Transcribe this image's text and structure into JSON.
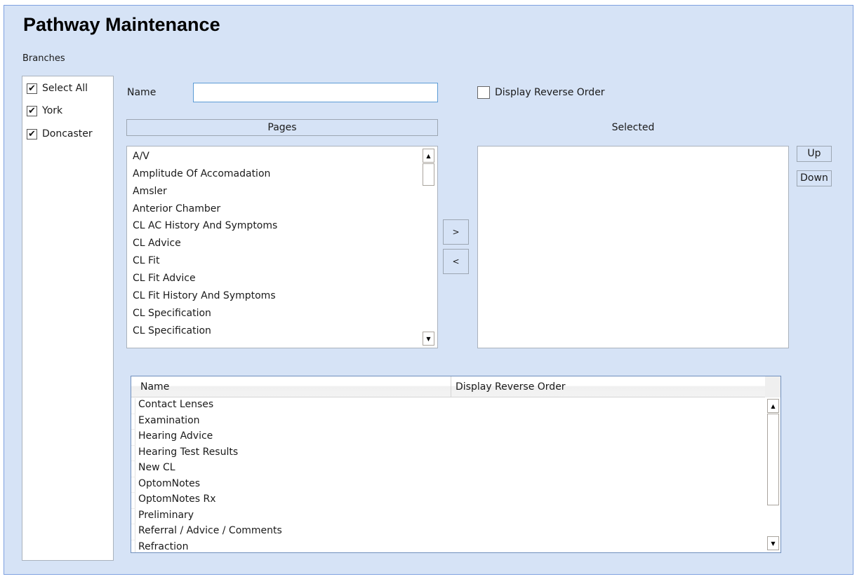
{
  "window": {
    "title": "Pathway Maintenance"
  },
  "branches": {
    "label": "Branches",
    "items": [
      {
        "label": "Select All",
        "checked": true
      },
      {
        "label": "York",
        "checked": true
      },
      {
        "label": "Doncaster",
        "checked": true
      }
    ]
  },
  "form": {
    "name_label": "Name",
    "name_value": "",
    "name_placeholder": "",
    "display_reverse_order_label": "Display Reverse Order",
    "display_reverse_order_checked": false
  },
  "pages": {
    "header": "Pages",
    "items": [
      "A/V",
      "Amplitude Of Accomadation",
      "Amsler",
      "Anterior Chamber",
      "CL AC History And Symptoms",
      "CL Advice",
      "CL Fit",
      "CL Fit Advice",
      "CL Fit History And Symptoms",
      "CL Specification",
      "CL Specification"
    ],
    "scroll_up_icon": "triangle-up-icon",
    "scroll_down_icon": "triangle-down-icon"
  },
  "transfer": {
    "add_label": ">",
    "remove_label": "<"
  },
  "selected": {
    "header": "Selected",
    "items": [],
    "up_label": "Up",
    "down_label": "Down"
  },
  "grid": {
    "columns": [
      "Name",
      "Display Reverse Order"
    ],
    "rows": [
      {
        "name": "Contact Lenses",
        "display_reverse_order": ""
      },
      {
        "name": "Examination",
        "display_reverse_order": ""
      },
      {
        "name": "Hearing Advice",
        "display_reverse_order": ""
      },
      {
        "name": "Hearing Test Results",
        "display_reverse_order": ""
      },
      {
        "name": "New CL",
        "display_reverse_order": ""
      },
      {
        "name": "OptomNotes",
        "display_reverse_order": ""
      },
      {
        "name": "OptomNotes Rx",
        "display_reverse_order": ""
      },
      {
        "name": "Preliminary",
        "display_reverse_order": ""
      },
      {
        "name": "Referral / Advice / Comments",
        "display_reverse_order": ""
      },
      {
        "name": "Refraction",
        "display_reverse_order": ""
      }
    ]
  },
  "icons": {
    "check": "✔",
    "up": "▲",
    "down": "▼"
  }
}
